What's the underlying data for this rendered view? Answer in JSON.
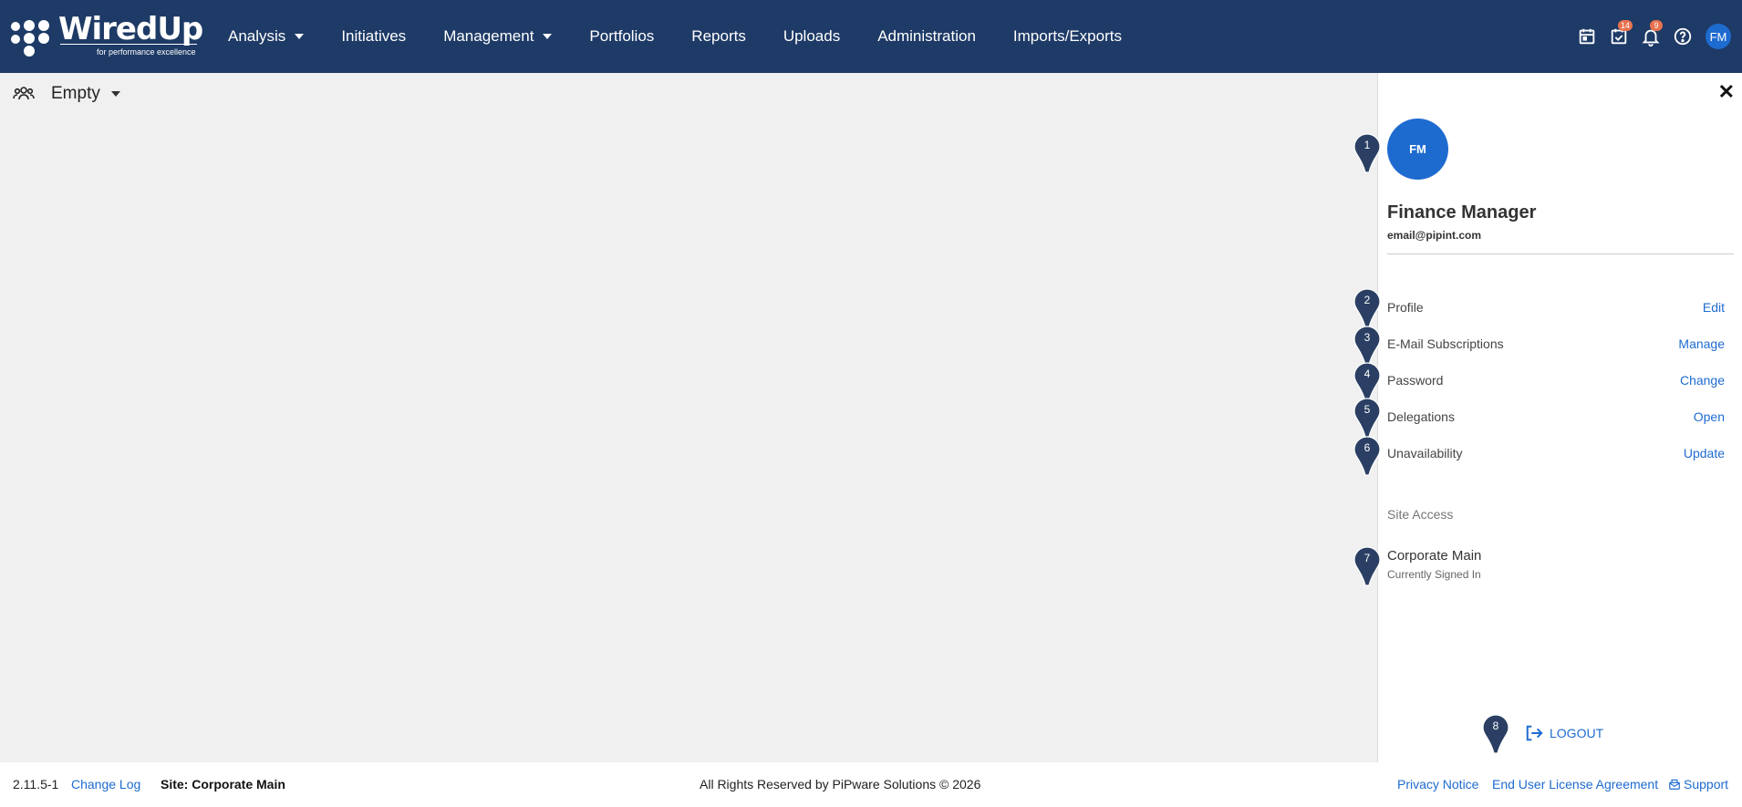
{
  "brand": {
    "name": "WiredUp",
    "tagline": "for performance excellence"
  },
  "nav": {
    "items": [
      {
        "label": "Analysis",
        "dropdown": true
      },
      {
        "label": "Initiatives",
        "dropdown": false
      },
      {
        "label": "Management",
        "dropdown": true
      },
      {
        "label": "Portfolios",
        "dropdown": false
      },
      {
        "label": "Reports",
        "dropdown": false
      },
      {
        "label": "Uploads",
        "dropdown": false
      },
      {
        "label": "Administration",
        "dropdown": false
      },
      {
        "label": "Imports/Exports",
        "dropdown": false
      }
    ]
  },
  "topbar": {
    "tasks_count": "14",
    "notifications_count": "9",
    "user_initials": "FM",
    "icons": [
      "calendar-icon",
      "tasks-icon",
      "bell-icon",
      "help-icon"
    ]
  },
  "subbar": {
    "selector_label": "Empty",
    "icon": "people-icon"
  },
  "panel": {
    "avatar_initials": "FM",
    "user_name": "Finance Manager",
    "user_email": "email@pipint.com",
    "rows": [
      {
        "label": "Profile",
        "action": "Edit"
      },
      {
        "label": "E-Mail Subscriptions",
        "action": "Manage"
      },
      {
        "label": "Password",
        "action": "Change"
      },
      {
        "label": "Delegations",
        "action": "Open"
      },
      {
        "label": "Unavailability",
        "action": "Update"
      }
    ],
    "site_access_label": "Site Access",
    "site_name": "Corporate Main",
    "site_status": "Currently Signed In",
    "logout_label": "LOGOUT"
  },
  "markers": [
    "1",
    "2",
    "3",
    "4",
    "5",
    "6",
    "7",
    "8"
  ],
  "footer": {
    "version": "2.11.5-1",
    "changelog": "Change Log",
    "site": "Site: Corporate Main",
    "copyright": "All Rights Reserved by PiPware Solutions © 2026",
    "privacy": "Privacy Notice",
    "eula": "End User License Agreement",
    "support": "Support"
  },
  "colors": {
    "navbar": "#1e3a66",
    "accent": "#1e6bd0",
    "badge": "#e8724f",
    "marker": "#2a3f63"
  }
}
